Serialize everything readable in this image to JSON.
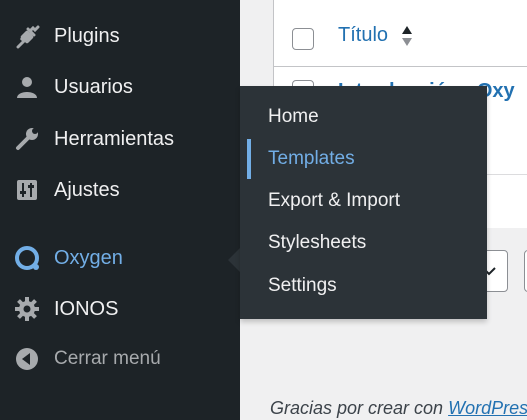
{
  "sidebar": {
    "items": [
      {
        "label": "Plugins",
        "icon": "plug-icon"
      },
      {
        "label": "Usuarios",
        "icon": "user-icon"
      },
      {
        "label": "Herramientas",
        "icon": "wrench-icon"
      },
      {
        "label": "Ajustes",
        "icon": "sliders-icon"
      },
      {
        "label": "Oxygen",
        "icon": "oxygen-logo-icon"
      },
      {
        "label": "IONOS",
        "icon": "gear-icon"
      },
      {
        "label": "Cerrar menú",
        "icon": "collapse-arrow-icon"
      }
    ]
  },
  "flyout": {
    "items": [
      "Home",
      "Templates",
      "Export & Import",
      "Stylesheets",
      "Settings"
    ],
    "active": "Templates"
  },
  "table": {
    "title_header": "Título",
    "row_title": "Introducción - Oxy"
  },
  "footer": {
    "text": "Gracias por crear con ",
    "link": "WordPress"
  },
  "colors": {
    "sidebar_bg": "#1d2327",
    "flyout_bg": "#2c3338",
    "accent": "#72aee6",
    "link": "#2271b1"
  }
}
